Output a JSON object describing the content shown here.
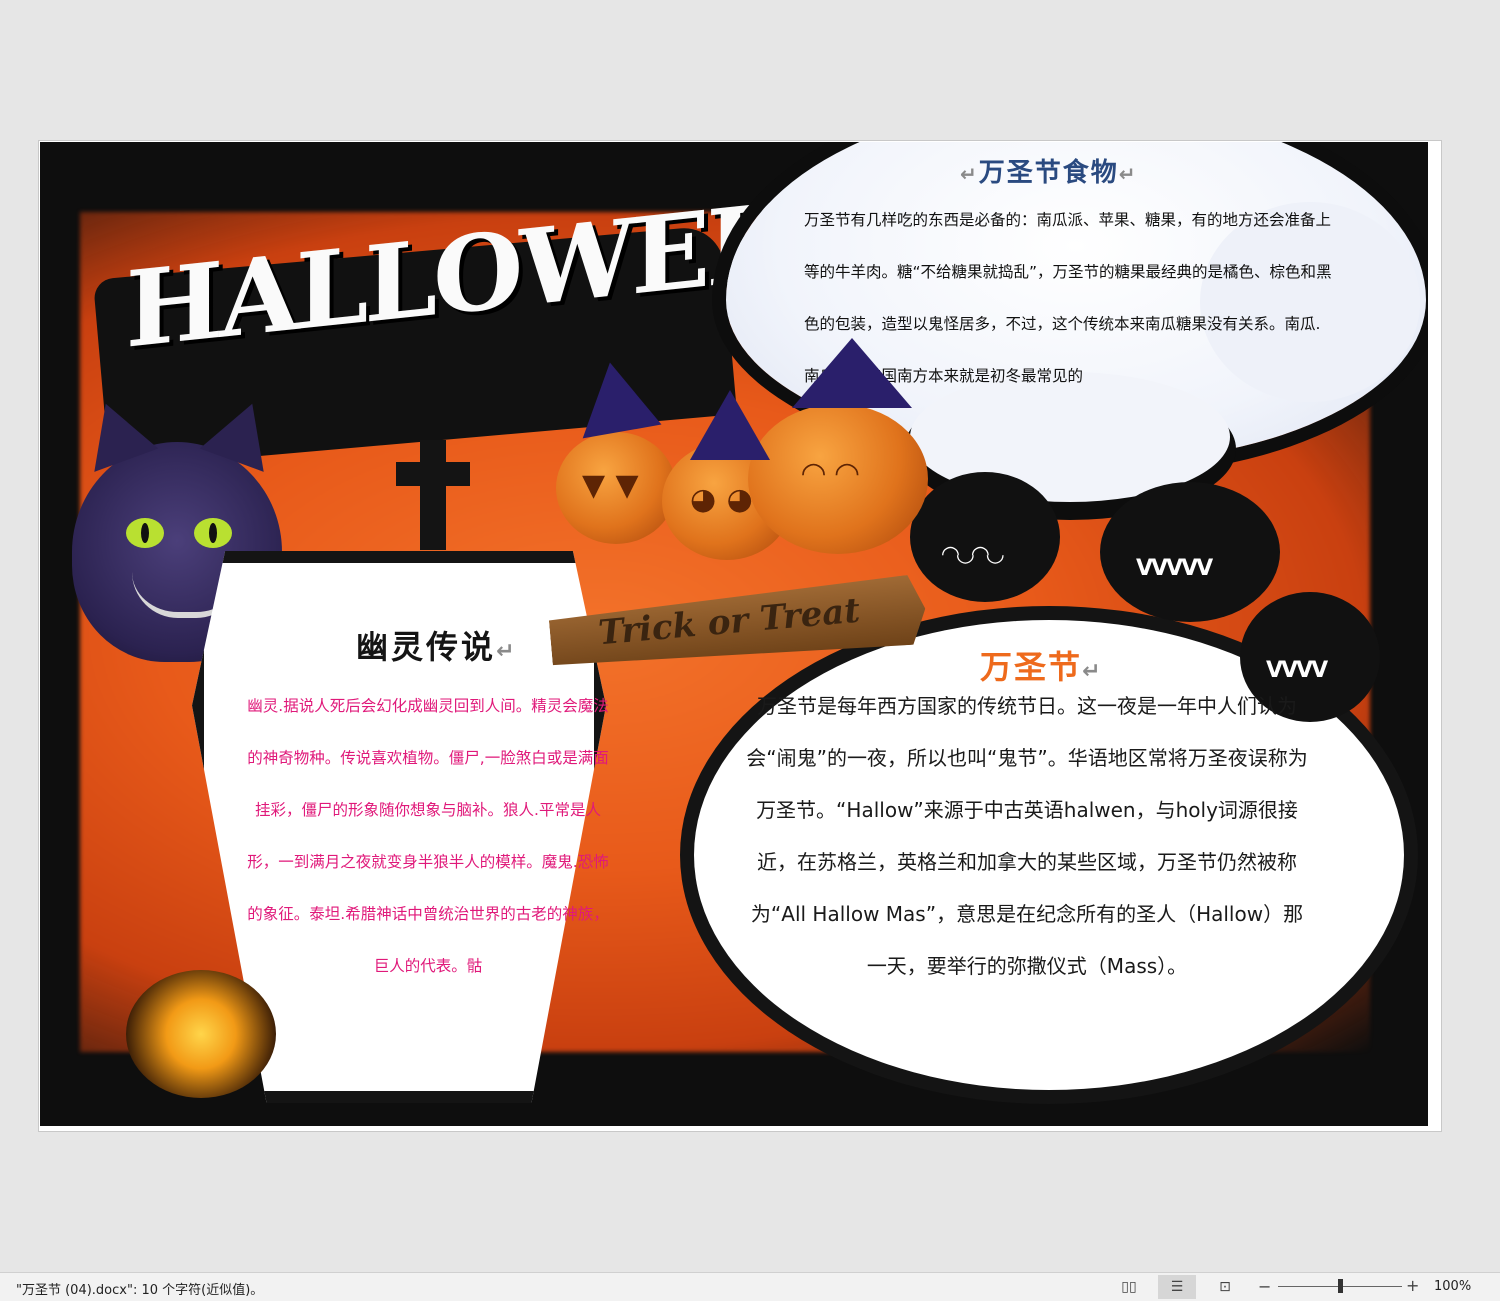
{
  "food": {
    "title": "万圣节食物",
    "text": "万圣节有几样吃的东西是必备的：南瓜派、苹果、糖果，有的地方还会准备上等的牛羊肉。糖“不给糖果就捣乱”，万圣节的糖果最经典的是橘色、棕色和黑色的包装，造型以鬼怪居多，不过，这个传统本来南瓜糖果没有关系。南瓜.南瓜派在美国南方本来就是初冬最常见的"
  },
  "poster_title": "HALLOWEEN",
  "sign_text": "Trick or Treat",
  "ghost": {
    "title": "幽灵传说",
    "text": "幽灵.据说人死后会幻化成幽灵回到人间。精灵会魔法的神奇物种。传说喜欢植物。僵尸,一脸煞白或是满面挂彩，僵尸的形象随你想象与脑补。狼人.平常是人形，一到满月之夜就变身半狼半人的模样。魔鬼.恐怖的象征。泰坦.希腊神话中曾统治世界的古老的神族，巨人的代表。骷"
  },
  "halloween": {
    "title": "万圣节",
    "text": "万圣节是每年西方国家的传统节日。这一夜是一年中人们认为会“闹鬼”的一夜，所以也叫“鬼节”。华语地区常将万圣夜误称为万圣节。“Hallow”来源于中古英语halwen，与holy词源很接近，在苏格兰，英格兰和加拿大的某些区域，万圣节仍然被称为“All Hallow Mas”，意思是在纪念所有的圣人（Hallow）那一天，要举行的弥撒仪式（Mass）。"
  },
  "pilcrow": "↵",
  "status": {
    "text": "\"万圣节 (04).docx\": 10 个字符(近似值)。",
    "zoom": "100%",
    "zoom_minus": "−",
    "zoom_plus": "+",
    "zoom_level": 0.5
  },
  "icons": [
    "read-mode-icon",
    "print-layout-icon",
    "web-layout-icon"
  ]
}
